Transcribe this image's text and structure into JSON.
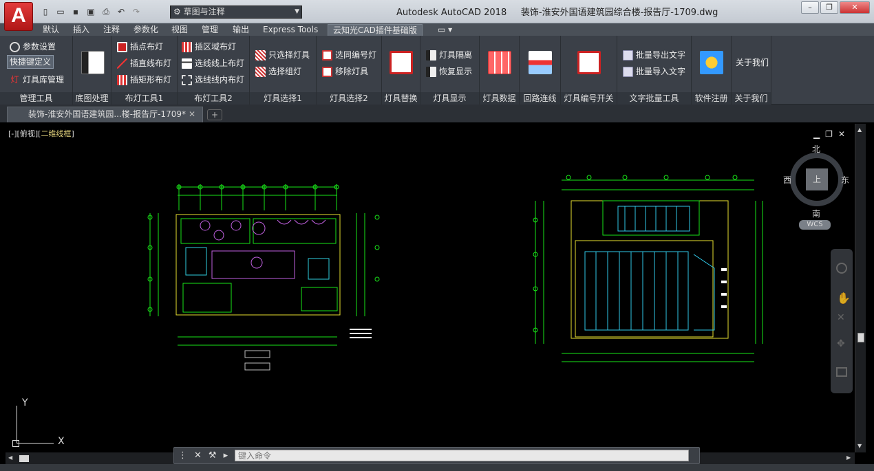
{
  "app": {
    "logo_letter": "A",
    "title": "Autodesk AutoCAD 2018",
    "filename": "装饰-淮安外国语建筑园综合楼-报告厅-1709.dwg",
    "workspace": "草图与注释"
  },
  "ribbon_tabs": [
    "默认",
    "插入",
    "注释",
    "参数化",
    "视图",
    "管理",
    "输出",
    "Express Tools",
    "云知光CAD插件基础版"
  ],
  "active_tab": "云知光CAD插件基础版",
  "panels": {
    "mgmt": {
      "title": "管理工具",
      "b1": "参数设置",
      "b2": "快捷键定义",
      "b3": "灯具库管理"
    },
    "pre": {
      "title": "底图处理"
    },
    "lamp1": {
      "title": "布灯工具1",
      "b1": "插点布灯",
      "b2": "插直线布灯",
      "b3": "插矩形布灯"
    },
    "lamp2": {
      "title": "布灯工具2",
      "b1": "插区域布灯",
      "b2": "选线线上布灯",
      "b3": "选线线内布灯"
    },
    "sel1": {
      "title": "灯具选择1",
      "b1": "只选择灯具",
      "b2": "选择组灯"
    },
    "sel2": {
      "title": "灯具选择2",
      "b1": "选同编号灯",
      "b2": "移除灯具"
    },
    "replace": {
      "title": "灯具替换"
    },
    "show": {
      "title": "灯具显示",
      "b1": "灯具隔离",
      "b2": "恢复显示"
    },
    "data": {
      "title": "灯具数据"
    },
    "loop": {
      "title": "回路连线"
    },
    "num": {
      "title": "灯具编号开关"
    },
    "text": {
      "title": "文字批量工具",
      "b1": "批量导出文字",
      "b2": "批量导入文字"
    },
    "reg": {
      "title": "软件注册"
    },
    "about": {
      "title": "关于我们",
      "label": "关于我们"
    }
  },
  "doc_tab": "装饰-淮安外国语建筑园...楼-报告厅-1709*",
  "viewport": {
    "label_a": "[-][俯视][",
    "label_b": "二维线框",
    "label_c": "]"
  },
  "compass": {
    "n": "北",
    "s": "南",
    "e": "东",
    "w": "西",
    "center": "上",
    "wcs": "WCS"
  },
  "ucs": {
    "x": "X",
    "y": "Y"
  },
  "command": {
    "placeholder": "键入命令"
  },
  "colors": {
    "ribbon": "#3b4048",
    "canvas": "#000000",
    "grid_green": "#19e619",
    "accent_red": "#c42020"
  }
}
